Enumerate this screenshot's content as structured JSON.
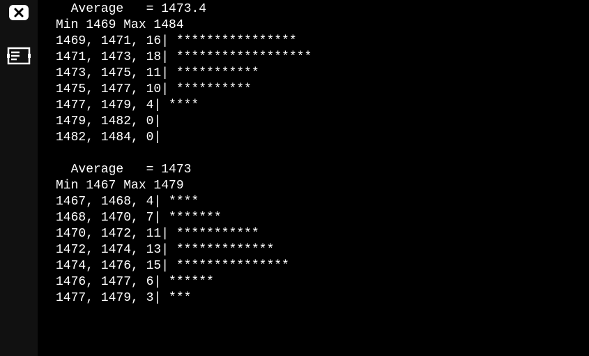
{
  "blocks": [
    {
      "average_label": "  Average   = ",
      "average_value": "1473.4",
      "minmax_label": "Min 1469 Max 1484",
      "rows": [
        {
          "lo": "1469",
          "hi": "1471",
          "count": "16",
          "count_pad": "",
          "bar": "****************"
        },
        {
          "lo": "1471",
          "hi": "1473",
          "count": "18",
          "count_pad": "",
          "bar": "******************"
        },
        {
          "lo": "1473",
          "hi": "1475",
          "count": "11",
          "count_pad": "",
          "bar": "***********"
        },
        {
          "lo": "1475",
          "hi": "1477",
          "count": "10",
          "count_pad": "",
          "bar": "**********"
        },
        {
          "lo": "1477",
          "hi": "1479",
          "count": "4",
          "count_pad": "",
          "bar": "****"
        },
        {
          "lo": "1479",
          "hi": "1482",
          "count": "0",
          "count_pad": "",
          "bar": ""
        },
        {
          "lo": "1482",
          "hi": "1484",
          "count": "0",
          "count_pad": "",
          "bar": ""
        }
      ]
    },
    {
      "average_label": "  Average   = ",
      "average_value": "1473",
      "minmax_label": "Min 1467 Max 1479",
      "rows": [
        {
          "lo": "1467",
          "hi": "1468",
          "count": "4",
          "count_pad": "",
          "bar": "****"
        },
        {
          "lo": "1468",
          "hi": "1470",
          "count": "7",
          "count_pad": "",
          "bar": "*******"
        },
        {
          "lo": "1470",
          "hi": "1472",
          "count": "11",
          "count_pad": "",
          "bar": "***********"
        },
        {
          "lo": "1472",
          "hi": "1474",
          "count": "13",
          "count_pad": "",
          "bar": "*************"
        },
        {
          "lo": "1474",
          "hi": "1476",
          "count": "15",
          "count_pad": "",
          "bar": "***************"
        },
        {
          "lo": "1476",
          "hi": "1477",
          "count": "6",
          "count_pad": "",
          "bar": "******"
        },
        {
          "lo": "1477",
          "hi": "1479",
          "count": "3",
          "count_pad": "",
          "bar": "***"
        }
      ]
    }
  ],
  "chart_data": [
    {
      "type": "bar",
      "title": "Histogram",
      "average": 1473.4,
      "min": 1469,
      "max": 1484,
      "bins": [
        {
          "range": [
            1469,
            1471
          ],
          "count": 16
        },
        {
          "range": [
            1471,
            1473
          ],
          "count": 18
        },
        {
          "range": [
            1473,
            1475
          ],
          "count": 11
        },
        {
          "range": [
            1475,
            1477
          ],
          "count": 10
        },
        {
          "range": [
            1477,
            1479
          ],
          "count": 4
        },
        {
          "range": [
            1479,
            1482
          ],
          "count": 0
        },
        {
          "range": [
            1482,
            1484
          ],
          "count": 0
        }
      ]
    },
    {
      "type": "bar",
      "title": "Histogram",
      "average": 1473,
      "min": 1467,
      "max": 1479,
      "bins": [
        {
          "range": [
            1467,
            1468
          ],
          "count": 4
        },
        {
          "range": [
            1468,
            1470
          ],
          "count": 7
        },
        {
          "range": [
            1470,
            1472
          ],
          "count": 11
        },
        {
          "range": [
            1472,
            1474
          ],
          "count": 13
        },
        {
          "range": [
            1474,
            1476
          ],
          "count": 15
        },
        {
          "range": [
            1476,
            1477
          ],
          "count": 6
        },
        {
          "range": [
            1477,
            1479
          ],
          "count": 3
        }
      ]
    }
  ]
}
